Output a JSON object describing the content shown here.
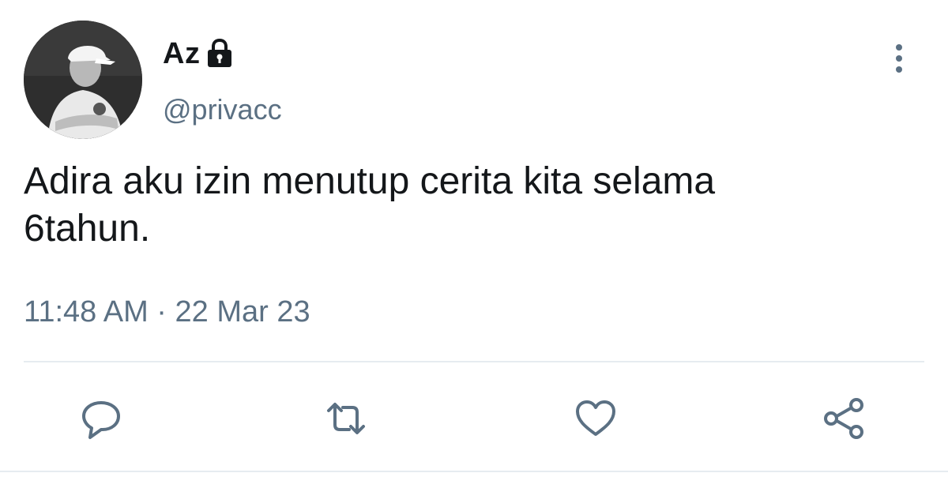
{
  "user": {
    "display_name": "Az",
    "handle": "@privacc",
    "protected": true
  },
  "tweet": {
    "text": "Adira aku izin menutup cerita kita selama\n6tahun.",
    "time": "11:48 AM",
    "separator": "·",
    "date": "22 Mar 23"
  },
  "actions": {
    "reply_icon": "reply-icon",
    "retweet_icon": "retweet-icon",
    "like_icon": "heart-icon",
    "share_icon": "share-icon"
  },
  "colors": {
    "text_primary": "#14171a",
    "text_secondary": "#5b7083",
    "icon": "#5b7083",
    "divider": "#e6ecf0"
  }
}
